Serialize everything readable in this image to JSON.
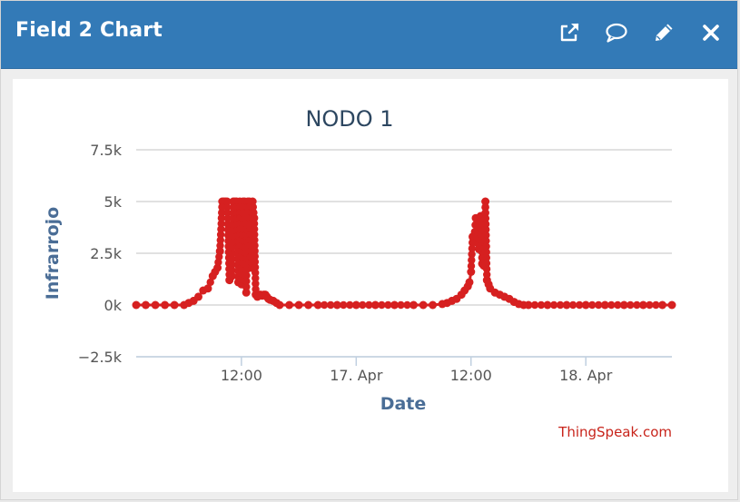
{
  "header": {
    "title": "Field 2 Chart"
  },
  "toolbar": {
    "icons": [
      "external-link-icon",
      "comment-icon",
      "pencil-icon",
      "close-icon"
    ]
  },
  "colors": {
    "header_bg": "#337ab7",
    "series": "#d62020",
    "axis_title": "#4a6d96",
    "title": "#2c4660",
    "credit": "#c8241b"
  },
  "chart_data": {
    "type": "line",
    "title": "NODO 1",
    "xlabel": "Date",
    "ylabel": "Infrarrojo",
    "ylim": [
      -2500,
      7500
    ],
    "yticks": [
      -2500,
      0,
      2500,
      5000,
      7500
    ],
    "ytick_labels": [
      "−2.5k",
      "0k",
      "2.5k",
      "5k",
      "7.5k"
    ],
    "xlim": [
      "2017-04-16T01:00",
      "2018-04-18T09:00"
    ],
    "xticks": [
      "2017-04-16T12:00",
      "2017-04-17T00:00",
      "2017-04-17T12:00",
      "2017-04-18T00:00"
    ],
    "xtick_labels": [
      "12:00",
      "17. Apr",
      "12:00",
      "18. Apr"
    ],
    "grid": true,
    "legend": "none",
    "credit": "ThingSpeak.com",
    "series": [
      {
        "x": [
          "2017-04-16T01:00",
          "2017-04-16T02:00",
          "2017-04-16T03:00",
          "2017-04-16T04:00",
          "2017-04-16T05:00",
          "2017-04-16T06:00",
          "2017-04-16T06:30",
          "2017-04-16T07:00",
          "2017-04-16T07:30",
          "2017-04-16T08:00",
          "2017-04-16T08:30",
          "2017-04-16T09:00",
          "2017-04-16T09:15",
          "2017-04-16T09:30",
          "2017-04-16T09:45",
          "2017-04-16T10:00",
          "2017-04-16T10:10",
          "2017-04-16T10:20",
          "2017-04-16T10:30",
          "2017-04-16T10:45",
          "2017-04-16T11:00",
          "2017-04-16T11:10",
          "2017-04-16T11:20",
          "2017-04-16T11:30",
          "2017-04-16T11:40",
          "2017-04-16T11:50",
          "2017-04-16T12:00",
          "2017-04-16T12:10",
          "2017-04-16T12:20",
          "2017-04-16T12:30",
          "2017-04-16T12:40",
          "2017-04-16T12:50",
          "2017-04-16T13:00",
          "2017-04-16T13:10",
          "2017-04-16T13:20",
          "2017-04-16T13:30",
          "2017-04-16T13:40",
          "2017-04-16T13:50",
          "2017-04-16T14:00",
          "2017-04-16T14:10",
          "2017-04-16T14:20",
          "2017-04-16T14:30",
          "2017-04-16T14:40",
          "2017-04-16T14:50",
          "2017-04-16T15:00",
          "2017-04-16T15:20",
          "2017-04-16T15:40",
          "2017-04-16T16:00",
          "2017-04-16T17:00",
          "2017-04-16T18:00",
          "2017-04-16T19:00",
          "2017-04-16T20:00",
          "2017-04-16T22:00",
          "2017-04-17T00:00",
          "2017-04-17T02:00",
          "2017-04-17T04:00",
          "2017-04-17T06:00",
          "2017-04-17T07:00",
          "2017-04-17T08:00",
          "2017-04-17T09:00",
          "2017-04-17T09:30",
          "2017-04-17T10:00",
          "2017-04-17T10:30",
          "2017-04-17T11:00",
          "2017-04-17T11:20",
          "2017-04-17T11:40",
          "2017-04-17T11:50",
          "2017-04-17T12:00",
          "2017-04-17T12:10",
          "2017-04-17T12:20",
          "2017-04-17T12:30",
          "2017-04-17T12:40",
          "2017-04-17T12:50",
          "2017-04-17T13:00",
          "2017-04-17T13:10",
          "2017-04-17T13:20",
          "2017-04-17T13:30",
          "2017-04-17T13:40",
          "2017-04-17T13:50",
          "2017-04-17T14:00",
          "2017-04-17T14:30",
          "2017-04-17T15:00",
          "2017-04-17T15:30",
          "2017-04-17T16:00",
          "2017-04-17T16:30",
          "2017-04-17T17:00",
          "2017-04-17T17:30",
          "2017-04-17T18:00",
          "2017-04-17T20:00",
          "2017-04-17T22:00",
          "2017-04-18T00:00",
          "2017-04-18T02:00",
          "2017-04-18T04:00",
          "2017-04-18T06:00",
          "2017-04-18T08:00",
          "2017-04-18T09:00"
        ],
        "values": [
          0,
          0,
          0,
          0,
          0,
          0,
          100,
          200,
          400,
          700,
          800,
          1400,
          1600,
          1800,
          2600,
          5000,
          5000,
          5000,
          5000,
          1200,
          1400,
          5000,
          5000,
          5000,
          1100,
          5000,
          1000,
          5000,
          5000,
          600,
          5000,
          5000,
          1800,
          5000,
          4200,
          500,
          400,
          500,
          500,
          450,
          500,
          500,
          400,
          300,
          250,
          200,
          100,
          0,
          0,
          0,
          0,
          0,
          0,
          0,
          0,
          0,
          0,
          0,
          0,
          50,
          100,
          200,
          300,
          500,
          700,
          900,
          1100,
          1600,
          3300,
          3200,
          4200,
          3000,
          2700,
          4300,
          2000,
          1900,
          5000,
          1200,
          1000,
          800,
          600,
          500,
          400,
          300,
          150,
          50,
          0,
          0,
          0,
          0,
          0,
          0,
          0,
          0,
          0,
          0
        ]
      }
    ]
  }
}
